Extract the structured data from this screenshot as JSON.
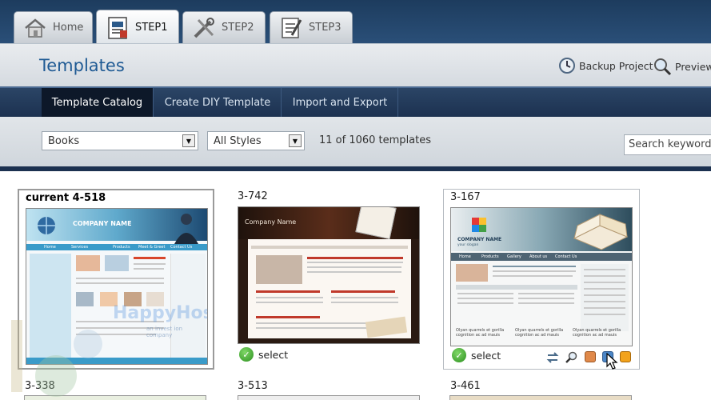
{
  "top_tabs": [
    {
      "label": "Home",
      "icon": "house-icon"
    },
    {
      "label": "STEP1",
      "icon": "document-icon"
    },
    {
      "label": "STEP2",
      "icon": "tools-icon"
    },
    {
      "label": "STEP3",
      "icon": "checklist-icon"
    }
  ],
  "header": {
    "title": "Templates",
    "backup_label": "Backup Project",
    "preview_label": "Preview"
  },
  "subnav": {
    "tabs": [
      "Template Catalog",
      "Create DIY Template",
      "Import and Export"
    ]
  },
  "filters": {
    "category": "Books",
    "style": "All Styles",
    "count": "11 of 1060 templates",
    "search_placeholder": "Search keyword"
  },
  "templates": [
    {
      "title": "current 4-518",
      "brand": "COMPANY NAME",
      "nav": [
        "Home",
        "Services",
        "Products",
        "Meet & Greet",
        "Contact Us"
      ],
      "promo": "Company Begunn es mendera del"
    },
    {
      "title": "3-742",
      "brand": "Company Name",
      "promo": "Company Begunn es mendera del",
      "select": "select"
    },
    {
      "title": "3-167",
      "brand": "COMPANY NAME",
      "tagline": "your slogan",
      "nav": [
        "Home",
        "Products",
        "Gallery",
        "About us",
        "Contact Us"
      ],
      "captions": [
        "Olyan quarrels et gorilla cognition ac ad mauis",
        "Olyan quarrels et gorilla cognition ac ad mauis",
        "Olyan quarrels et gorilla cognition ac ad mauis"
      ],
      "select": "select"
    },
    {
      "title": "3-338"
    },
    {
      "title": "3-513"
    },
    {
      "title": "3-461"
    }
  ],
  "watermark": {
    "text": "HappyHosts",
    "sub": "an invest ion company"
  },
  "colors": {
    "accent": "#1f5a94",
    "nav_dark": "#1c3150",
    "select_green": "#3aa52b"
  }
}
